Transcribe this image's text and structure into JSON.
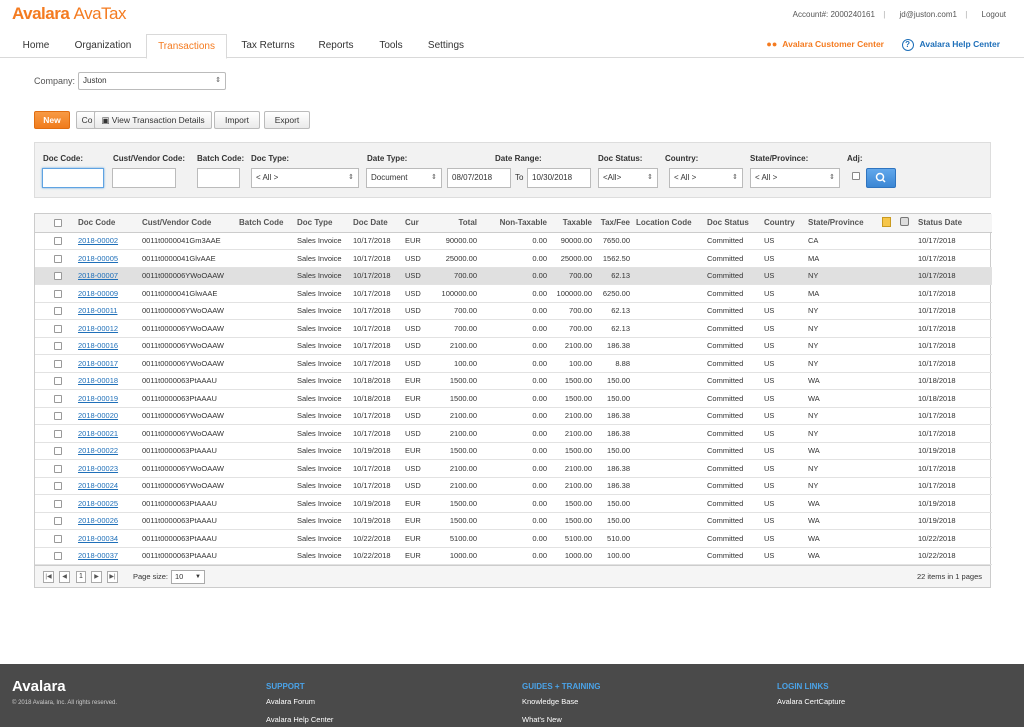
{
  "brand": {
    "logo": "Avalara",
    "product": "AvaTax"
  },
  "account": {
    "number": "Account#: 2000240161",
    "user": "jd@juston.com1",
    "logout": "Logout"
  },
  "nav": {
    "tabs": [
      "Home",
      "Organization",
      "Transactions",
      "Tax Returns",
      "Reports",
      "Tools",
      "Settings"
    ],
    "active": "Transactions",
    "customer_center": "Avalara Customer Center",
    "help_center": "Avalara Help Center"
  },
  "company": {
    "label": "Company:",
    "value": "Juston"
  },
  "buttons": {
    "new": "New",
    "copy": "Co",
    "view_details": "View Transaction Details",
    "import": "Import",
    "export": "Export"
  },
  "filters": {
    "doc_code": "Doc Code:",
    "cust_vendor_code": "Cust/Vendor Code:",
    "batch_code": "Batch Code:",
    "doc_type": "Doc Type:",
    "doc_type_value": "< All >",
    "date_type": "Date Type:",
    "date_type_value": "Document",
    "date_range": "Date Range:",
    "date_from": "08/07/2018",
    "to_label": "To",
    "date_to": "10/30/2018",
    "doc_status": "Doc Status:",
    "doc_status_value": "<All>",
    "country": "Country:",
    "country_value": "< All >",
    "state": "State/Province:",
    "state_value": "< All >",
    "adj": "Adj:"
  },
  "table": {
    "headers": [
      "Doc Code",
      "Cust/Vendor Code",
      "Batch Code",
      "Doc Type",
      "Doc Date",
      "Cur",
      "Total",
      "Non-Taxable",
      "Taxable",
      "Tax/Fee",
      "Location Code",
      "Doc Status",
      "Country",
      "State/Province",
      "Status Date"
    ],
    "rows": [
      [
        "2018-00002",
        "0011t0000041Gm3AAE",
        "",
        "Sales Invoice",
        "10/17/2018",
        "EUR",
        "90000.00",
        "0.00",
        "90000.00",
        "7650.00",
        "",
        "Committed",
        "US",
        "CA",
        "10/17/2018"
      ],
      [
        "2018-00005",
        "0011t0000041GlvAAE",
        "",
        "Sales Invoice",
        "10/17/2018",
        "USD",
        "25000.00",
        "0.00",
        "25000.00",
        "1562.50",
        "",
        "Committed",
        "US",
        "MA",
        "10/17/2018"
      ],
      [
        "2018-00007",
        "0011t000006YWoOAAW",
        "",
        "Sales Invoice",
        "10/17/2018",
        "USD",
        "700.00",
        "0.00",
        "700.00",
        "62.13",
        "",
        "Committed",
        "US",
        "NY",
        "10/17/2018"
      ],
      [
        "2018-00009",
        "0011t0000041GlwAAE",
        "",
        "Sales Invoice",
        "10/17/2018",
        "USD",
        "100000.00",
        "0.00",
        "100000.00",
        "6250.00",
        "",
        "Committed",
        "US",
        "MA",
        "10/17/2018"
      ],
      [
        "2018-00011",
        "0011t000006YWoOAAW",
        "",
        "Sales Invoice",
        "10/17/2018",
        "USD",
        "700.00",
        "0.00",
        "700.00",
        "62.13",
        "",
        "Committed",
        "US",
        "NY",
        "10/17/2018"
      ],
      [
        "2018-00012",
        "0011t000006YWoOAAW",
        "",
        "Sales Invoice",
        "10/17/2018",
        "USD",
        "700.00",
        "0.00",
        "700.00",
        "62.13",
        "",
        "Committed",
        "US",
        "NY",
        "10/17/2018"
      ],
      [
        "2018-00016",
        "0011t000006YWoOAAW",
        "",
        "Sales Invoice",
        "10/17/2018",
        "USD",
        "2100.00",
        "0.00",
        "2100.00",
        "186.38",
        "",
        "Committed",
        "US",
        "NY",
        "10/17/2018"
      ],
      [
        "2018-00017",
        "0011t000006YWoOAAW",
        "",
        "Sales Invoice",
        "10/17/2018",
        "USD",
        "100.00",
        "0.00",
        "100.00",
        "8.88",
        "",
        "Committed",
        "US",
        "NY",
        "10/17/2018"
      ],
      [
        "2018-00018",
        "0011t0000063PtAAAU",
        "",
        "Sales Invoice",
        "10/18/2018",
        "EUR",
        "1500.00",
        "0.00",
        "1500.00",
        "150.00",
        "",
        "Committed",
        "US",
        "WA",
        "10/18/2018"
      ],
      [
        "2018-00019",
        "0011t0000063PtAAAU",
        "",
        "Sales Invoice",
        "10/18/2018",
        "EUR",
        "1500.00",
        "0.00",
        "1500.00",
        "150.00",
        "",
        "Committed",
        "US",
        "WA",
        "10/18/2018"
      ],
      [
        "2018-00020",
        "0011t000006YWoOAAW",
        "",
        "Sales Invoice",
        "10/17/2018",
        "USD",
        "2100.00",
        "0.00",
        "2100.00",
        "186.38",
        "",
        "Committed",
        "US",
        "NY",
        "10/17/2018"
      ],
      [
        "2018-00021",
        "0011t000006YWoOAAW",
        "",
        "Sales Invoice",
        "10/17/2018",
        "USD",
        "2100.00",
        "0.00",
        "2100.00",
        "186.38",
        "",
        "Committed",
        "US",
        "NY",
        "10/17/2018"
      ],
      [
        "2018-00022",
        "0011t0000063PtAAAU",
        "",
        "Sales Invoice",
        "10/19/2018",
        "EUR",
        "1500.00",
        "0.00",
        "1500.00",
        "150.00",
        "",
        "Committed",
        "US",
        "WA",
        "10/19/2018"
      ],
      [
        "2018-00023",
        "0011t000006YWoOAAW",
        "",
        "Sales Invoice",
        "10/17/2018",
        "USD",
        "2100.00",
        "0.00",
        "2100.00",
        "186.38",
        "",
        "Committed",
        "US",
        "NY",
        "10/17/2018"
      ],
      [
        "2018-00024",
        "0011t000006YWoOAAW",
        "",
        "Sales Invoice",
        "10/17/2018",
        "USD",
        "2100.00",
        "0.00",
        "2100.00",
        "186.38",
        "",
        "Committed",
        "US",
        "NY",
        "10/17/2018"
      ],
      [
        "2018-00025",
        "0011t0000063PtAAAU",
        "",
        "Sales Invoice",
        "10/19/2018",
        "EUR",
        "1500.00",
        "0.00",
        "1500.00",
        "150.00",
        "",
        "Committed",
        "US",
        "WA",
        "10/19/2018"
      ],
      [
        "2018-00026",
        "0011t0000063PtAAAU",
        "",
        "Sales Invoice",
        "10/19/2018",
        "EUR",
        "1500.00",
        "0.00",
        "1500.00",
        "150.00",
        "",
        "Committed",
        "US",
        "WA",
        "10/19/2018"
      ],
      [
        "2018-00034",
        "0011t0000063PtAAAU",
        "",
        "Sales Invoice",
        "10/22/2018",
        "EUR",
        "5100.00",
        "0.00",
        "5100.00",
        "510.00",
        "",
        "Committed",
        "US",
        "WA",
        "10/22/2018"
      ],
      [
        "2018-00037",
        "0011t0000063PtAAAU",
        "",
        "Sales Invoice",
        "10/22/2018",
        "EUR",
        "1000.00",
        "0.00",
        "1000.00",
        "100.00",
        "",
        "Committed",
        "US",
        "WA",
        "10/22/2018"
      ]
    ],
    "highlighted_row": 2
  },
  "pager": {
    "page": "1",
    "page_size_label": "Page size:",
    "page_size": "10",
    "info": "22 items in 1 pages"
  },
  "footer": {
    "logo": "Avalara",
    "copyright": "© 2018 Avalara, Inc. All rights reserved.",
    "support": {
      "heading": "SUPPORT",
      "links": [
        "Avalara Forum",
        "Avalara Help Center"
      ]
    },
    "guides": {
      "heading": "GUIDES + TRAINING",
      "links": [
        "Knowledge Base",
        "What's New"
      ]
    },
    "login": {
      "heading": "LOGIN LINKS",
      "links": [
        "Avalara CertCapture"
      ]
    }
  },
  "colors": {
    "accent": "#f47b20",
    "link": "#1e6fb9",
    "footer_bg": "#4a4a4a"
  }
}
